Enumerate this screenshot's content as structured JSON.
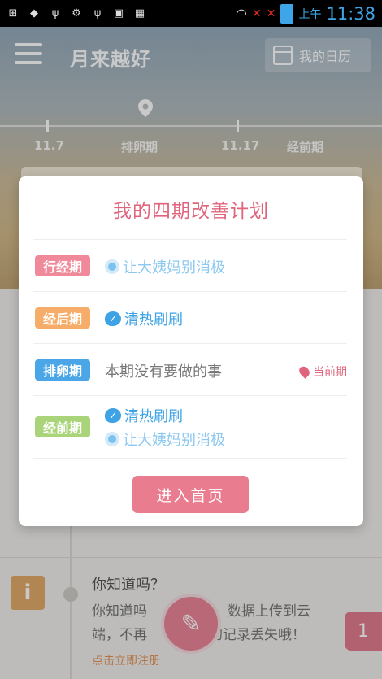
{
  "status_bar": {
    "ampm": "上午",
    "time": "11:38",
    "sim1": "1",
    "sim2": "2"
  },
  "app_bar": {
    "title": "月来越好",
    "calendar_button": "我的日历"
  },
  "timeline": {
    "labels": [
      "11.7",
      "排卵期",
      "11.17",
      "经前期"
    ]
  },
  "dialog": {
    "title": "我的四期改善计划",
    "rows": [
      {
        "tag": "行经期",
        "tag_color": "#f0899a",
        "items": [
          {
            "icon": "radio-icon",
            "text": "让大姨妈别消极",
            "color": "#8cc8f0"
          }
        ]
      },
      {
        "tag": "经后期",
        "tag_color": "#f6ad6a",
        "items": [
          {
            "icon": "check-bubble-icon",
            "text": "清热刷刷",
            "color": "#3ea3e4"
          }
        ]
      },
      {
        "tag": "排卵期",
        "tag_color": "#4aa6e6",
        "items": [
          {
            "icon": "",
            "text": "本期没有要做的事",
            "color": "#777777"
          }
        ],
        "current_label": "当前期"
      },
      {
        "tag": "经前期",
        "tag_color": "#a9d47a",
        "items": [
          {
            "icon": "check-bubble-icon",
            "text": "清热刷刷",
            "color": "#3ea3e4"
          },
          {
            "icon": "radio-icon",
            "text": "让大姨妈别消极",
            "color": "#8cc8f0"
          }
        ]
      }
    ],
    "enter_button": "进入首页"
  },
  "tip": {
    "title": "你知道吗？",
    "body_line1_left": "你知道吗",
    "body_line1_right": "，数据上传到云",
    "body_line2_left": "端，不再",
    "body_line2_right": "的记录丢失哦！",
    "link": "点击立即注册"
  },
  "badge_count": "1"
}
